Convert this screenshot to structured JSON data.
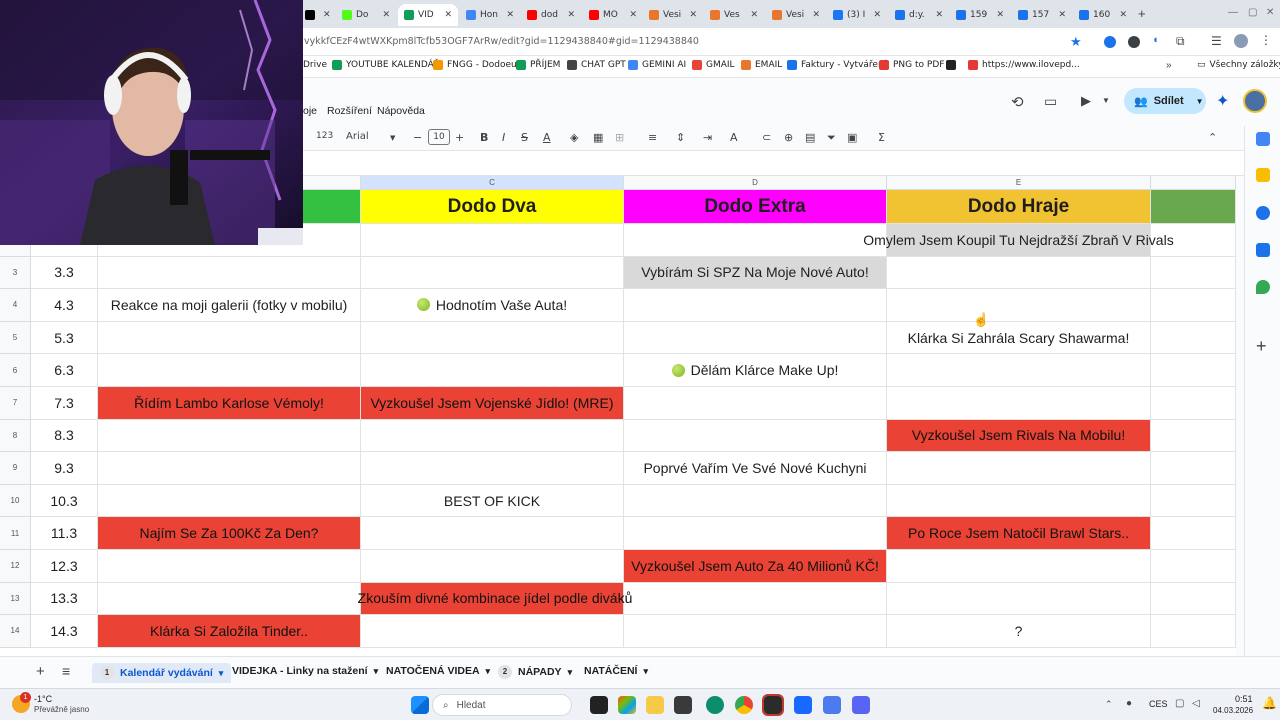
{
  "browser": {
    "tabs": [
      {
        "label": "",
        "icon": "tiktok-icon",
        "color": "#000000",
        "active": false
      },
      {
        "label": "Do",
        "icon": "kick-icon",
        "color": "#53fc18",
        "active": false
      },
      {
        "label": "VID",
        "icon": "sheets-icon",
        "color": "#0f9d58",
        "active": true
      },
      {
        "label": "Hon",
        "icon": "docs-icon",
        "color": "#4285f4",
        "active": false
      },
      {
        "label": "dod",
        "icon": "youtube-icon",
        "color": "#ff0000",
        "active": false
      },
      {
        "label": "MO",
        "icon": "youtube-icon",
        "color": "#ff0000",
        "active": false
      },
      {
        "label": "Vesi",
        "icon": "vesi-icon",
        "color": "#e8762d",
        "active": false
      },
      {
        "label": "Ves",
        "icon": "vesi-icon",
        "color": "#e8762d",
        "active": false
      },
      {
        "label": "Vesi",
        "icon": "vesi-icon",
        "color": "#e8762d",
        "active": false
      },
      {
        "label": "(3) I",
        "icon": "facebook-icon",
        "color": "#1877f2",
        "active": false
      },
      {
        "label": "d:y.",
        "icon": "d-icon",
        "color": "#1a73e8",
        "active": false
      },
      {
        "label": "159",
        "icon": "d-icon",
        "color": "#1a73e8",
        "active": false
      },
      {
        "label": "157",
        "icon": "d-icon",
        "color": "#1a73e8",
        "active": false
      },
      {
        "label": "160",
        "icon": "d-icon",
        "color": "#1a73e8",
        "active": false
      }
    ],
    "url": "vykkfCEzF4wtWXKpm8lTcfb53OGF7ArRw/edit?gid=1129438840#gid=1129438840",
    "bookmarks": [
      {
        "label": "Drive",
        "color": "#fbbc04"
      },
      {
        "label": "YOUTUBE KALENDÁŘ",
        "color": "#0f9d58"
      },
      {
        "label": "FNGG - Dodoeu",
        "color": "#f29900"
      },
      {
        "label": "PŘÍJEM",
        "color": "#0f9d58"
      },
      {
        "label": "CHAT GPT",
        "color": "#444444"
      },
      {
        "label": "GEMINI AI",
        "color": "#4285f4"
      },
      {
        "label": "GMAIL",
        "color": "#ea4335"
      },
      {
        "label": "EMAIL",
        "color": "#e8762d"
      },
      {
        "label": "Faktury - Vytváření",
        "color": "#1a73e8"
      },
      {
        "label": "PNG to PDF",
        "color": "#e53935"
      },
      {
        "label": "",
        "color": "#222222"
      },
      {
        "label": "https://www.ilovepd...",
        "color": "#e53935"
      }
    ],
    "all_bookmarks": "Všechny záložky"
  },
  "sheets": {
    "menus": [
      "oje",
      "Rozšíření",
      "Nápověda"
    ],
    "toolbar": {
      "zoom": "123",
      "font": "Arial",
      "font_size": "10"
    },
    "share_label": "Sdílet",
    "columns": [
      {
        "letter": "",
        "header": ""
      },
      {
        "letter": "C",
        "header": "Dodo Dva"
      },
      {
        "letter": "D",
        "header": "Dodo Extra"
      },
      {
        "letter": "E",
        "header": "Dodo Hraje"
      },
      {
        "letter": "",
        "header": ""
      }
    ],
    "header_colors": [
      "#34c142",
      "#ffff00",
      "#ff00ff",
      "#f1c232",
      "#6aa84f"
    ],
    "rows": [
      {
        "num": "",
        "date": "",
        "cells": [
          "",
          "",
          "",
          "Omylem Jsem Koupil Tu Nejdražší Zbraň V Rivals"
        ],
        "colors": [
          "",
          "",
          "",
          "gray"
        ],
        "apples": [
          false,
          false,
          false,
          false
        ]
      },
      {
        "num": "3",
        "date": "3.3",
        "cells": [
          "",
          "",
          "Vybírám Si SPZ Na Moje Nové Auto!",
          ""
        ],
        "colors": [
          "",
          "",
          "gray",
          ""
        ],
        "apples": [
          false,
          false,
          false,
          false
        ]
      },
      {
        "num": "4",
        "date": "4.3",
        "cells": [
          "Reakce na moji galerii (fotky v mobilu)",
          "Hodnotím Vaše Auta!",
          "",
          ""
        ],
        "colors": [
          "",
          "",
          "",
          ""
        ],
        "apples": [
          false,
          true,
          false,
          false
        ]
      },
      {
        "num": "5",
        "date": "5.3",
        "cells": [
          "",
          "",
          "",
          "Klárka Si Zahrála Scary Shawarma!"
        ],
        "colors": [
          "",
          "",
          "",
          ""
        ],
        "apples": [
          false,
          false,
          false,
          false
        ]
      },
      {
        "num": "6",
        "date": "6.3",
        "cells": [
          "",
          "",
          "Dělám Klárce Make Up!",
          ""
        ],
        "colors": [
          "",
          "",
          "",
          ""
        ],
        "apples": [
          false,
          false,
          true,
          false
        ]
      },
      {
        "num": "7",
        "date": "7.3",
        "cells": [
          "Řídím Lambo Karlose Vémoly!",
          "Vyzkoušel Jsem Vojenské Jídlo! (MRE)",
          "",
          ""
        ],
        "colors": [
          "red",
          "red",
          "",
          ""
        ],
        "apples": [
          false,
          false,
          false,
          false
        ]
      },
      {
        "num": "8",
        "date": "8.3",
        "cells": [
          "",
          "",
          "",
          "Vyzkoušel Jsem Rivals Na Mobilu!"
        ],
        "colors": [
          "",
          "",
          "",
          "red"
        ],
        "apples": [
          false,
          false,
          false,
          false
        ]
      },
      {
        "num": "9",
        "date": "9.3",
        "cells": [
          "",
          "",
          "Poprvé Vařím Ve Své Nové Kuchyni",
          ""
        ],
        "colors": [
          "",
          "",
          "",
          ""
        ],
        "apples": [
          false,
          false,
          false,
          false
        ]
      },
      {
        "num": "10",
        "date": "10.3",
        "cells": [
          "",
          "BEST OF KICK",
          "",
          ""
        ],
        "colors": [
          "",
          "",
          "",
          ""
        ],
        "apples": [
          false,
          false,
          false,
          false
        ]
      },
      {
        "num": "11",
        "date": "11.3",
        "cells": [
          "Najím Se Za 100Kč Za Den?",
          "",
          "",
          "Po Roce Jsem Natočil Brawl Stars.."
        ],
        "colors": [
          "red",
          "",
          "",
          "red"
        ],
        "apples": [
          false,
          false,
          false,
          false
        ]
      },
      {
        "num": "12",
        "date": "12.3",
        "cells": [
          "",
          "",
          "Vyzkoušel Jsem Auto Za 40 Milionů KČ!",
          ""
        ],
        "colors": [
          "",
          "",
          "red",
          ""
        ],
        "apples": [
          false,
          false,
          false,
          false
        ]
      },
      {
        "num": "13",
        "date": "13.3",
        "cells": [
          "",
          "Zkouším divné kombinace jídel podle diváků",
          "",
          ""
        ],
        "colors": [
          "",
          "red",
          "",
          ""
        ],
        "apples": [
          false,
          true,
          false,
          false
        ]
      },
      {
        "num": "14",
        "date": "14.3",
        "cells": [
          "Klárka Si Založila Tinder..",
          "",
          "",
          "?"
        ],
        "colors": [
          "red",
          "",
          "",
          ""
        ],
        "apples": [
          false,
          false,
          false,
          false
        ]
      }
    ],
    "sheet_tabs": [
      {
        "badge": "1",
        "label": "Kalendář vydávání",
        "active": true
      },
      {
        "badge": "",
        "label": "VIDEJKA - Linky na stažení",
        "active": false
      },
      {
        "badge": "",
        "label": "NATOČENÁ VIDEA",
        "active": false
      },
      {
        "badge": "2",
        "label": "NÁPADY",
        "active": false
      },
      {
        "badge": "",
        "label": "NATÁČENÍ",
        "active": false
      }
    ]
  },
  "taskbar": {
    "weather_temp": "-1°C",
    "weather_desc": "Převážně jasno",
    "weather_badge": "1",
    "search_placeholder": "Hledat",
    "lang": "CES",
    "time": "0:51",
    "date": "04.03.2026"
  }
}
